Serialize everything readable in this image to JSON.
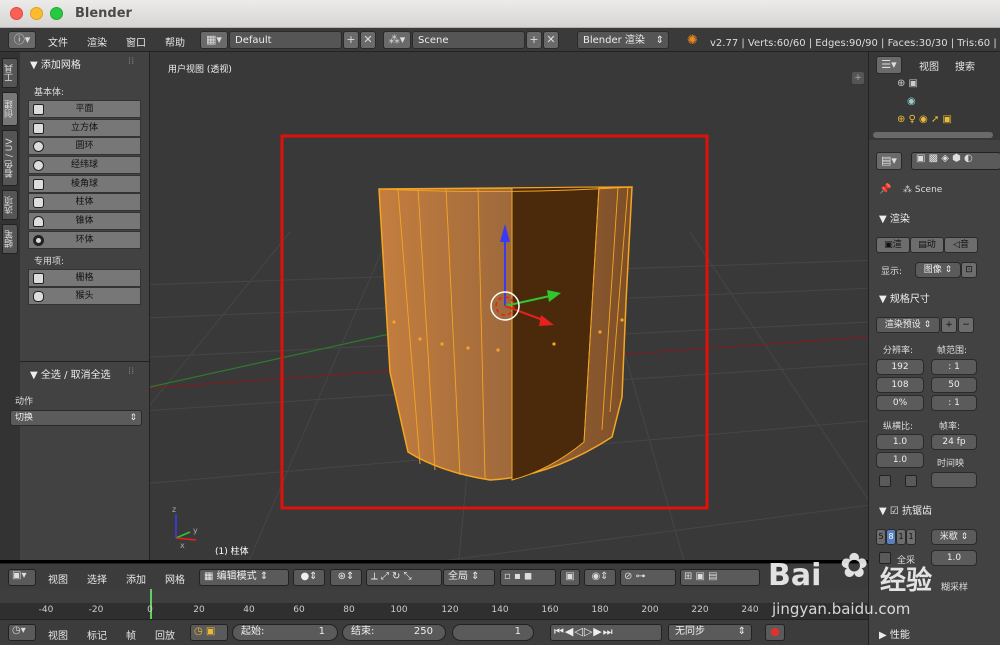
{
  "window": {
    "title": "Blender"
  },
  "infobar": {
    "menus": [
      "文件",
      "渲染",
      "窗口",
      "帮助"
    ],
    "layout": "Default",
    "scene": "Scene",
    "engine": "Blender 渲染",
    "stats": "v2.77 | Verts:60/60 | Edges:90/90 | Faces:30/30 | Tris:60 | 内"
  },
  "left_tabs": [
    "工具",
    "创建",
    "着色 / UV",
    "选项",
    "蜡笔"
  ],
  "toolshelf": {
    "panel_title": "添加网格",
    "primitives_label": "基本体:",
    "primitives": [
      "平面",
      "立方体",
      "圆环",
      "经纬球",
      "棱角球",
      "柱体",
      "锥体",
      "环体"
    ],
    "special_label": "专用项:",
    "special": [
      "栅格",
      "猴头"
    ],
    "operator_title": "全选 / 取消全选",
    "action_label": "动作",
    "action_value": "切换"
  },
  "viewport": {
    "label": "用户视图 (透视)",
    "object_label": "(1) 柱体",
    "axis_x": "x",
    "axis_y": "y",
    "axis_z": "z"
  },
  "outliner": {
    "tabs": [
      "视图",
      "搜索"
    ]
  },
  "properties": {
    "scene": "Scene",
    "render_title": "渲染",
    "render_btn": "渲",
    "anim_btn": "动",
    "audio_btn": "音",
    "display_label": "显示:",
    "display_value": "图像",
    "dimensions_title": "规格尺寸",
    "preset": "渲染预设",
    "resolution_label": "分辨率:",
    "frame_range_label": "帧范围:",
    "res_x": "192",
    "res_y": "108",
    "res_pct": "0%",
    "frame_step_a": ": 1",
    "frame_end": "50",
    "frame_step_b": ": 1",
    "aspect_label": "纵横比:",
    "fps_label": "帧率:",
    "aspect_x": "1.0",
    "aspect_y": "1.0",
    "fps": "24 fp",
    "time_remap": "时间映",
    "aa_title": "抗锯齿",
    "aa_samples": [
      "5",
      "8",
      "1",
      "1"
    ],
    "aa_filter": "米歇",
    "full_sample": "全采",
    "filter_size": "1.0",
    "motion_blur": "糊采样",
    "performance": "性能"
  },
  "header3d": {
    "menus": [
      "视图",
      "选择",
      "添加",
      "网格"
    ],
    "mode": "编辑模式",
    "orientation": "全局"
  },
  "timeline": {
    "ticks": [
      "-40",
      "-20",
      "0",
      "20",
      "40",
      "60",
      "80",
      "100",
      "120",
      "140",
      "160",
      "180",
      "200",
      "220",
      "240"
    ]
  },
  "timebar": {
    "menus": [
      "视图",
      "标记",
      "帧",
      "回放"
    ],
    "start_label": "起始:",
    "start_value": "1",
    "end_label": "结束:",
    "end_value": "250",
    "current": "1",
    "sync": "无同步"
  },
  "watermark": {
    "brand": "Bai",
    "brand2": "经验",
    "url": "jingyan.baidu.com"
  }
}
